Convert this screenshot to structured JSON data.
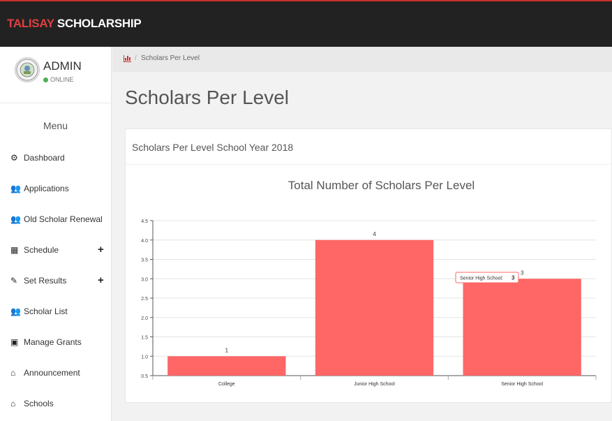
{
  "header": {
    "brand_red": "TALISAY",
    "brand_white": " SCHOLARSHIP"
  },
  "user": {
    "name": "ADMIN",
    "status": "ONLINE"
  },
  "sidebar": {
    "menu_title": "Menu",
    "items": [
      {
        "label": "Dashboard",
        "icon": "dashboard-icon",
        "glyph": "⚙",
        "expandable": false
      },
      {
        "label": "Applications",
        "icon": "users-icon",
        "glyph": "👥",
        "expandable": false
      },
      {
        "label": "Old Scholar Renewal",
        "icon": "users-icon",
        "glyph": "👥",
        "expandable": false
      },
      {
        "label": "Schedule",
        "icon": "calendar-icon",
        "glyph": "▦",
        "expandable": true
      },
      {
        "label": "Set Results",
        "icon": "pencil-icon",
        "glyph": "✎",
        "expandable": true
      },
      {
        "label": "Scholar List",
        "icon": "users-icon",
        "glyph": "👥",
        "expandable": false
      },
      {
        "label": "Manage Grants",
        "icon": "money-icon",
        "glyph": "▣",
        "expandable": false
      },
      {
        "label": "Announcement",
        "icon": "home-icon",
        "glyph": "⌂",
        "expandable": false
      },
      {
        "label": "Schools",
        "icon": "home-icon",
        "glyph": "⌂",
        "expandable": false
      }
    ]
  },
  "breadcrumb": {
    "sep": "/",
    "current": "Scholars Per Level"
  },
  "page": {
    "title": "Scholars Per Level"
  },
  "panel": {
    "title": "Scholars Per Level School Year 2018"
  },
  "chart_data": {
    "type": "bar",
    "title": "Total Number of Scholars Per Level",
    "categories": [
      "College",
      "Junior High School",
      "Senior High School"
    ],
    "values": [
      1,
      4,
      3
    ],
    "ylim": [
      0.5,
      4.5
    ],
    "yticks": [
      "0.5",
      "1.0",
      "1.5",
      "2.0",
      "2.5",
      "3.0",
      "3.5",
      "4.0",
      "4.5"
    ],
    "grid": true,
    "bar_color": "#ff6666",
    "tooltip": {
      "label": "Senior High School:",
      "value": "3"
    }
  }
}
